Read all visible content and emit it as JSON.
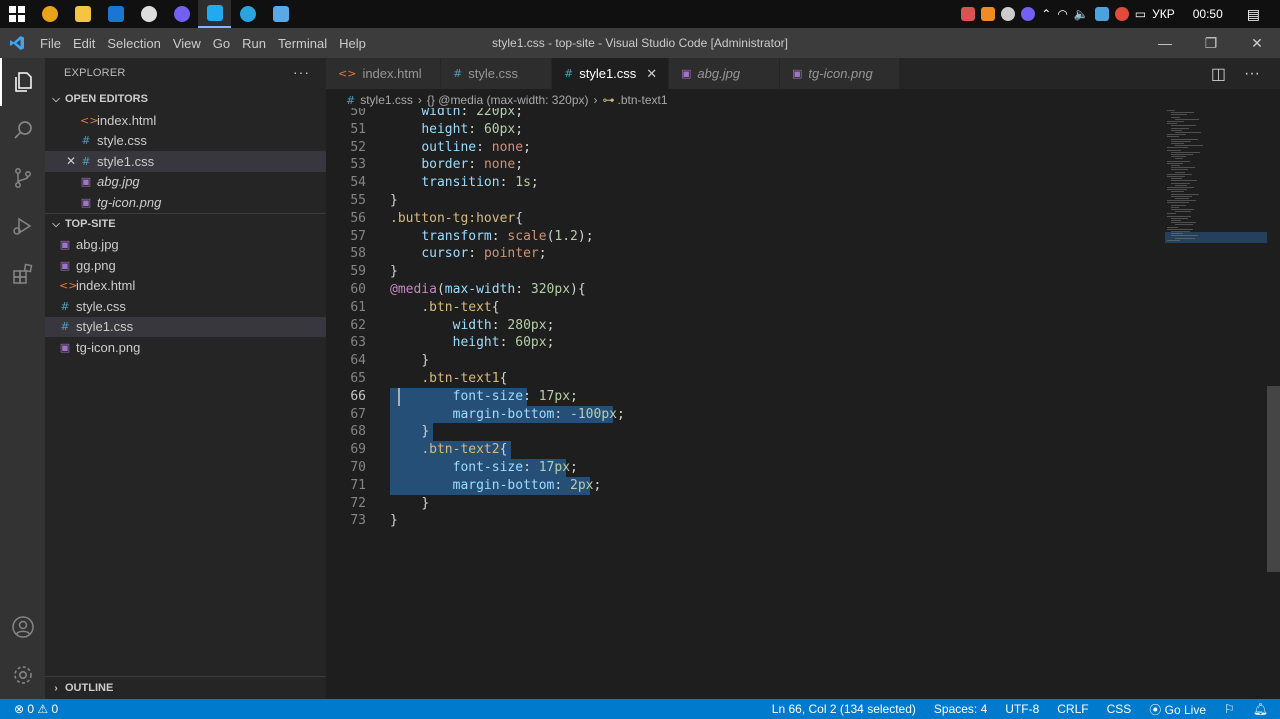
{
  "taskbar": {
    "apps": [
      {
        "icon": "chrome-icon",
        "color": "#e8a317"
      },
      {
        "icon": "file-explorer-icon",
        "color": "#f4c542"
      },
      {
        "icon": "photoshop-icon",
        "color": "#1b76d3"
      },
      {
        "icon": "obs-icon",
        "color": "#dedede"
      },
      {
        "icon": "viber-icon",
        "color": "#7360f2"
      },
      {
        "icon": "vscode-icon",
        "color": "#23a9f2"
      },
      {
        "icon": "telegram-icon",
        "color": "#2aa3df"
      },
      {
        "icon": "image-viewer-icon",
        "color": "#5aa9e6"
      }
    ],
    "language": "УКР",
    "time": "00:50"
  },
  "titlebar": {
    "menu": [
      "File",
      "Edit",
      "Selection",
      "View",
      "Go",
      "Run",
      "Terminal",
      "Help"
    ],
    "title": "style1.css - top-site - Visual Studio Code [Administrator]"
  },
  "sidebar": {
    "header": "EXPLORER",
    "more": "···",
    "open_editors_title": "OPEN EDITORS",
    "open_editors": [
      {
        "name": "index.html",
        "icon": "html-file-icon",
        "glyph": "<>",
        "type": "html"
      },
      {
        "name": "style.css",
        "icon": "css-file-icon",
        "glyph": "#",
        "type": "css"
      },
      {
        "name": "style1.css",
        "icon": "css-file-icon",
        "glyph": "#",
        "type": "css"
      },
      {
        "name": "abg.jpg",
        "icon": "image-file-icon",
        "glyph": "▣",
        "type": "img"
      },
      {
        "name": "tg-icon.png",
        "icon": "image-file-icon",
        "glyph": "▣",
        "type": "img"
      }
    ],
    "folder_title": "TOP-SITE",
    "files": [
      {
        "name": "abg.jpg",
        "glyph": "▣",
        "type": "img"
      },
      {
        "name": "gg.png",
        "glyph": "▣",
        "type": "img"
      },
      {
        "name": "index.html",
        "glyph": "<>",
        "type": "html"
      },
      {
        "name": "style.css",
        "glyph": "#",
        "type": "css"
      },
      {
        "name": "style1.css",
        "glyph": "#",
        "type": "css"
      },
      {
        "name": "tg-icon.png",
        "glyph": "▣",
        "type": "img"
      }
    ],
    "outline_title": "OUTLINE"
  },
  "tabs": [
    {
      "name": "index.html",
      "glyph": "<>",
      "type": "html"
    },
    {
      "name": "style.css",
      "glyph": "#",
      "type": "css"
    },
    {
      "name": "style1.css",
      "glyph": "#",
      "type": "css",
      "active": true
    },
    {
      "name": "abg.jpg",
      "glyph": "▣",
      "type": "img"
    },
    {
      "name": "tg-icon.png",
      "glyph": "▣",
      "type": "img"
    }
  ],
  "breadcrumb": {
    "file": "style1.css",
    "media": "{} @media (max-width: 320px)",
    "selector": ".btn-text1"
  },
  "editor": {
    "current_line": 66,
    "lines": [
      {
        "n": 50,
        "tokens": [
          [
            "    ",
            "p"
          ],
          [
            "width",
            "prop"
          ],
          [
            ": ",
            "p"
          ],
          [
            "220px",
            "num"
          ],
          [
            ";",
            "p"
          ]
        ]
      },
      {
        "n": 51,
        "tokens": [
          [
            "    ",
            "p"
          ],
          [
            "height",
            "prop"
          ],
          [
            ": ",
            "p"
          ],
          [
            "60px",
            "num"
          ],
          [
            ";",
            "p"
          ]
        ]
      },
      {
        "n": 52,
        "tokens": [
          [
            "    ",
            "p"
          ],
          [
            "outline",
            "prop"
          ],
          [
            ": ",
            "p"
          ],
          [
            "none",
            "val"
          ],
          [
            ";",
            "p"
          ]
        ]
      },
      {
        "n": 53,
        "tokens": [
          [
            "    ",
            "p"
          ],
          [
            "border",
            "prop"
          ],
          [
            ": ",
            "p"
          ],
          [
            "none",
            "val"
          ],
          [
            ";",
            "p"
          ]
        ]
      },
      {
        "n": 54,
        "tokens": [
          [
            "    ",
            "p"
          ],
          [
            "transition",
            "prop"
          ],
          [
            ": ",
            "p"
          ],
          [
            "1s",
            "num"
          ],
          [
            ";",
            "p"
          ]
        ]
      },
      {
        "n": 55,
        "tokens": [
          [
            "}",
            "p"
          ]
        ]
      },
      {
        "n": 56,
        "tokens": [
          [
            ".button-tg:hover",
            "sel"
          ],
          [
            "{",
            "p"
          ]
        ]
      },
      {
        "n": 57,
        "tokens": [
          [
            "    ",
            "p"
          ],
          [
            "transform",
            "prop"
          ],
          [
            ": ",
            "p"
          ],
          [
            "scale",
            "val"
          ],
          [
            "(",
            "p"
          ],
          [
            "1.2",
            "num"
          ],
          [
            ");",
            "p"
          ]
        ]
      },
      {
        "n": 58,
        "tokens": [
          [
            "    ",
            "p"
          ],
          [
            "cursor",
            "prop"
          ],
          [
            ": ",
            "p"
          ],
          [
            "pointer",
            "val"
          ],
          [
            ";",
            "p"
          ]
        ]
      },
      {
        "n": 59,
        "tokens": [
          [
            "}",
            "p"
          ]
        ]
      },
      {
        "n": 60,
        "tokens": [
          [
            "@media",
            "at"
          ],
          [
            "(",
            "p"
          ],
          [
            "max-width",
            "prop"
          ],
          [
            ": ",
            "p"
          ],
          [
            "320px",
            "num"
          ],
          [
            "){",
            "p"
          ]
        ]
      },
      {
        "n": 61,
        "tokens": [
          [
            "    ",
            "p"
          ],
          [
            ".btn-text",
            "sel"
          ],
          [
            "{",
            "p"
          ]
        ]
      },
      {
        "n": 62,
        "tokens": [
          [
            "        ",
            "p"
          ],
          [
            "width",
            "prop"
          ],
          [
            ": ",
            "p"
          ],
          [
            "280px",
            "num"
          ],
          [
            ";",
            "p"
          ]
        ]
      },
      {
        "n": 63,
        "tokens": [
          [
            "        ",
            "p"
          ],
          [
            "height",
            "prop"
          ],
          [
            ": ",
            "p"
          ],
          [
            "60px",
            "num"
          ],
          [
            ";",
            "p"
          ]
        ]
      },
      {
        "n": 64,
        "tokens": [
          [
            "    ",
            "p"
          ],
          [
            "}",
            "p"
          ]
        ]
      },
      {
        "n": 65,
        "tokens": [
          [
            "    ",
            "p"
          ],
          [
            ".btn-text1",
            "sel"
          ],
          [
            "{",
            "p"
          ]
        ]
      },
      {
        "n": 66,
        "tokens": [
          [
            "        ",
            "p"
          ],
          [
            "font-size",
            "prop"
          ],
          [
            ": ",
            "p"
          ],
          [
            "17px",
            "num"
          ],
          [
            ";",
            "p"
          ]
        ]
      },
      {
        "n": 67,
        "tokens": [
          [
            "        ",
            "p"
          ],
          [
            "margin-bottom",
            "prop"
          ],
          [
            ": ",
            "p"
          ],
          [
            "-100px",
            "num"
          ],
          [
            ";",
            "p"
          ]
        ]
      },
      {
        "n": 68,
        "tokens": [
          [
            "    ",
            "p"
          ],
          [
            "}",
            "p"
          ]
        ]
      },
      {
        "n": 69,
        "tokens": [
          [
            "    ",
            "p"
          ],
          [
            ".btn-text2",
            "sel"
          ],
          [
            "{",
            "p"
          ]
        ]
      },
      {
        "n": 70,
        "tokens": [
          [
            "        ",
            "p"
          ],
          [
            "font-size",
            "prop"
          ],
          [
            ": ",
            "p"
          ],
          [
            "17px",
            "num"
          ],
          [
            ";",
            "p"
          ]
        ]
      },
      {
        "n": 71,
        "tokens": [
          [
            "        ",
            "p"
          ],
          [
            "margin-bottom",
            "prop"
          ],
          [
            ": ",
            "p"
          ],
          [
            "2px",
            "num"
          ],
          [
            ";",
            "p"
          ]
        ]
      },
      {
        "n": 72,
        "tokens": [
          [
            "    ",
            "p"
          ],
          [
            "}",
            "p"
          ]
        ]
      },
      {
        "n": 73,
        "tokens": [
          [
            "}",
            "p"
          ]
        ]
      }
    ]
  },
  "statusbar": {
    "problems": "⊗ 0 ⚠ 0",
    "position": "Ln 66, Col 2 (134 selected)",
    "spaces": "Spaces: 4",
    "encoding": "UTF-8",
    "eol": "CRLF",
    "language": "CSS",
    "golive": "⦿ Go Live"
  },
  "colors": {
    "accent": "#007acc",
    "selection": "#264f78"
  }
}
